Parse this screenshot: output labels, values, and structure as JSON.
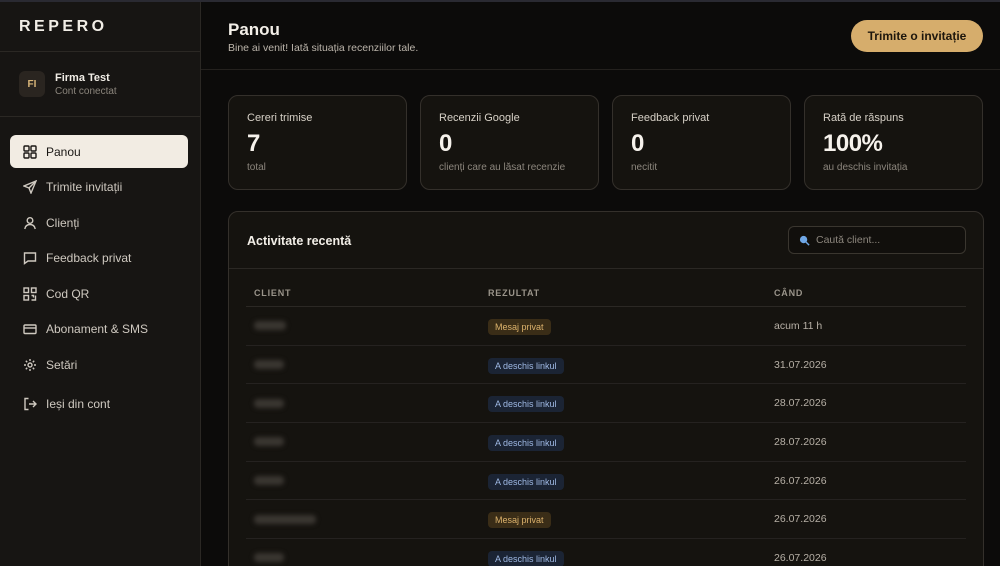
{
  "brand": {
    "logo": "REPERO"
  },
  "account": {
    "initials": "FI",
    "name": "Firma Test",
    "status": "Cont conectat"
  },
  "nav": {
    "items": [
      {
        "label": "Panou",
        "icon": "grid-icon"
      },
      {
        "label": "Trimite invitații",
        "icon": "send-icon"
      },
      {
        "label": "Clienți",
        "icon": "user-icon"
      },
      {
        "label": "Feedback privat",
        "icon": "message-icon"
      },
      {
        "label": "Cod QR",
        "icon": "qr-icon"
      },
      {
        "label": "Abonament & SMS",
        "icon": "card-icon"
      },
      {
        "label": "Setări",
        "icon": "gear-icon"
      }
    ],
    "logout": {
      "label": "Ieși din cont",
      "icon": "logout-icon"
    }
  },
  "header": {
    "title": "Panou",
    "subtitle": "Bine ai venit! Iată situația recenziilor tale.",
    "invite_button": "Trimite o invitație"
  },
  "stats": [
    {
      "label": "Cereri trimise",
      "value": "7",
      "hint": "total"
    },
    {
      "label": "Recenzii Google",
      "value": "0",
      "hint": "clienți care au lăsat recenzie"
    },
    {
      "label": "Feedback privat",
      "value": "0",
      "hint": "necitit"
    },
    {
      "label": "Rată de răspuns",
      "value": "100%",
      "hint": "au deschis invitația"
    }
  ],
  "activity": {
    "title": "Activitate recentă",
    "search_placeholder": "Caută client...",
    "columns": {
      "client": "CLIENT",
      "result": "REZULTAT",
      "when": "CÂND"
    },
    "rows": [
      {
        "result": "Mesaj privat",
        "type": "priv",
        "when": "acum 11 h"
      },
      {
        "result": "A deschis linkul",
        "type": "link",
        "when": "31.07.2026"
      },
      {
        "result": "A deschis linkul",
        "type": "link",
        "when": "28.07.2026"
      },
      {
        "result": "A deschis linkul",
        "type": "link",
        "when": "28.07.2026"
      },
      {
        "result": "A deschis linkul",
        "type": "link",
        "when": "26.07.2026"
      },
      {
        "result": "Mesaj privat",
        "type": "priv",
        "when": "26.07.2026"
      },
      {
        "result": "A deschis linkul",
        "type": "link",
        "when": "26.07.2026"
      }
    ]
  },
  "colors": {
    "accent": "#d6ad6c",
    "private_badge": "#dcb26c",
    "link_badge": "#9fb9e4"
  }
}
